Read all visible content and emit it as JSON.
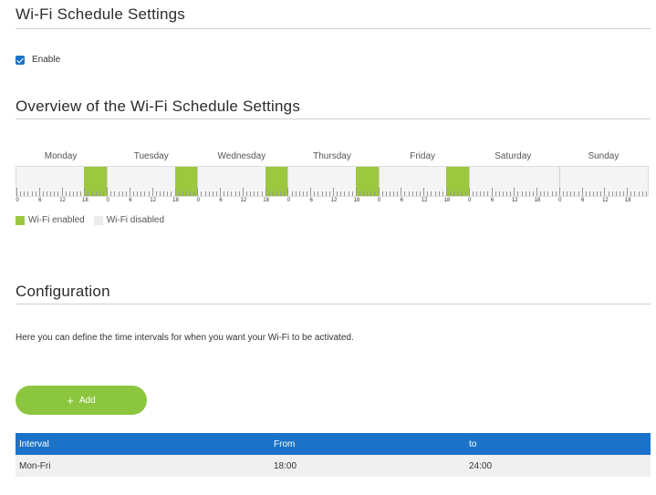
{
  "sections": {
    "schedule_title": "Wi-Fi Schedule Settings",
    "overview_title": "Overview of the Wi-Fi Schedule Settings",
    "config_title": "Configuration"
  },
  "enable": {
    "label": "Enable",
    "checked": true
  },
  "overview": {
    "days": [
      "Monday",
      "Tuesday",
      "Wednesday",
      "Thursday",
      "Friday",
      "Saturday",
      "Sunday"
    ],
    "hour_labels": [
      "0",
      "6",
      "12",
      "18"
    ],
    "enabled_intervals": [
      {
        "day": "Monday",
        "from": "18:00",
        "to": "24:00"
      },
      {
        "day": "Tuesday",
        "from": "18:00",
        "to": "24:00"
      },
      {
        "day": "Wednesday",
        "from": "18:00",
        "to": "24:00"
      },
      {
        "day": "Thursday",
        "from": "18:00",
        "to": "24:00"
      },
      {
        "day": "Friday",
        "from": "18:00",
        "to": "24:00"
      }
    ],
    "colors": {
      "enabled": "#9bc83e",
      "disabled": "#ececec"
    }
  },
  "legend": {
    "enabled_label": "Wi-Fi enabled",
    "disabled_label": "Wi-Fi disabled"
  },
  "config": {
    "description": "Here you can define the time intervals for when you want your Wi-Fi to be activated.",
    "add_label": "Add",
    "add_icon": "plus-icon"
  },
  "table": {
    "headers": [
      "Interval",
      "From",
      "to"
    ],
    "rows": [
      {
        "interval": "Mon-Fri",
        "from": "18:00",
        "to": "24:00"
      }
    ]
  },
  "accent_colors": {
    "primary": "#1a73c8",
    "button": "#8cc63f"
  }
}
